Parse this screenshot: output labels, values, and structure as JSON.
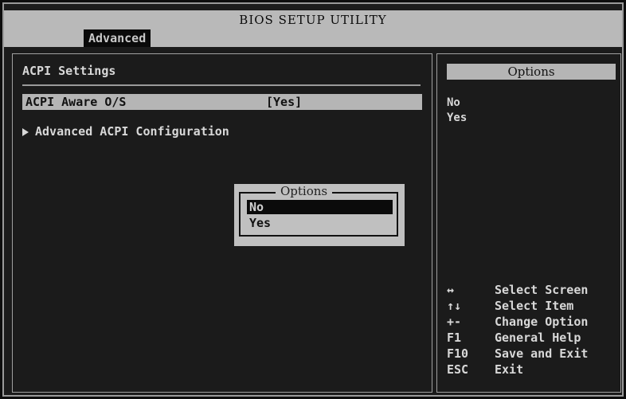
{
  "header": {
    "title": "BIOS SETUP UTILITY",
    "active_tab": "Advanced"
  },
  "main": {
    "section_title": "ACPI Settings",
    "items": [
      {
        "label": "ACPI Aware O/S",
        "value": "[Yes]"
      },
      {
        "label": "Advanced ACPI Configuration"
      }
    ]
  },
  "popup": {
    "title": "Options",
    "options": [
      "No",
      "Yes"
    ],
    "selected": "No"
  },
  "sidebar": {
    "options_title": "Options",
    "options": [
      "No",
      "Yes"
    ],
    "help": [
      {
        "key": "↔",
        "action": "Select Screen"
      },
      {
        "key": "↑↓",
        "action": "Select Item"
      },
      {
        "key": "+-",
        "action": "Change Option"
      },
      {
        "key": "F1",
        "action": "General Help"
      },
      {
        "key": "F10",
        "action": "Save and Exit"
      },
      {
        "key": "ESC",
        "action": "Exit"
      }
    ]
  }
}
